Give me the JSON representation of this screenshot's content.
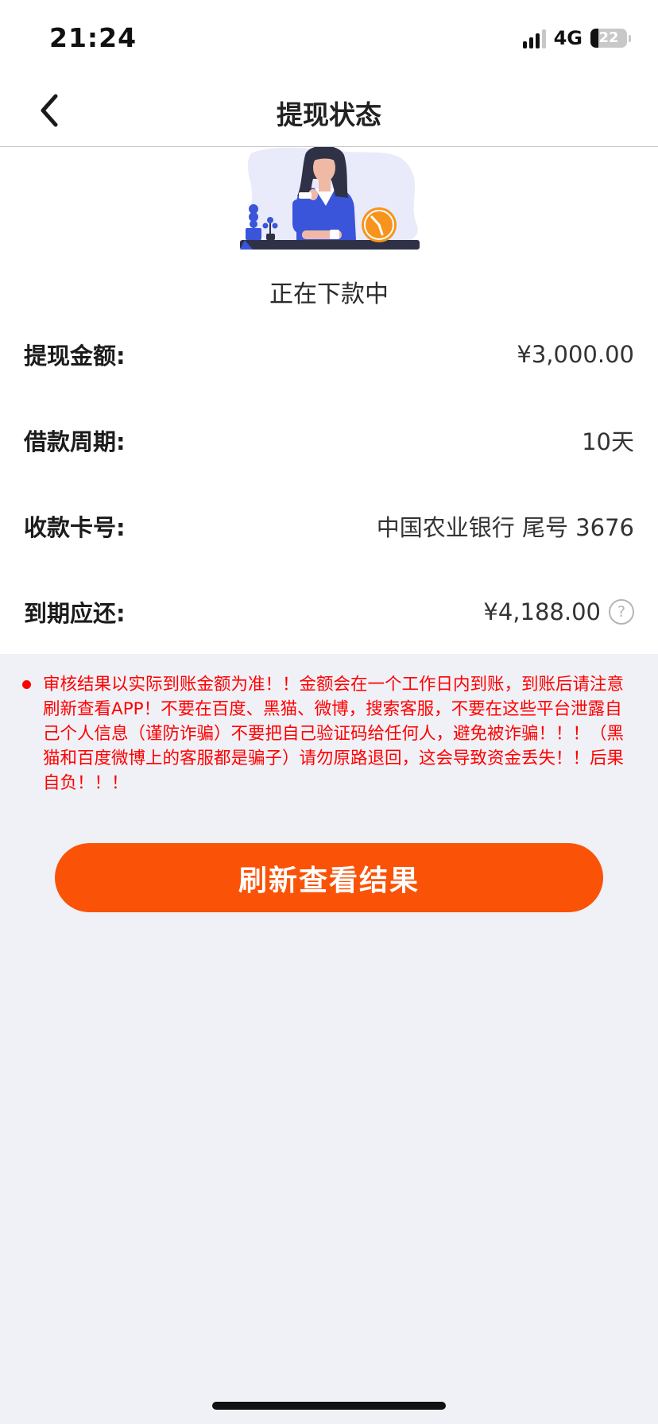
{
  "status_bar": {
    "time": "21:24",
    "network": "4G",
    "battery": "22",
    "icons": [
      "signal-bars-icon",
      "battery-icon"
    ]
  },
  "header": {
    "title": "提现状态",
    "back_icon": "chevron-left-icon"
  },
  "status": {
    "illustration": "woman-waiting-clock-illustration",
    "text": "正在下款中"
  },
  "details": [
    {
      "label": "提现金额:",
      "value": "¥3,000.00"
    },
    {
      "label": "借款周期:",
      "value": "10天"
    },
    {
      "label": "收款卡号:",
      "value": "中国农业银行 尾号 3676"
    },
    {
      "label": "到期应还:",
      "value": "¥4,188.00",
      "help_icon": "?"
    }
  ],
  "notice": {
    "text": "审核结果以实际到账金额为准！！金额会在一个工作日内到账，到账后请注意刷新查看APP！不要在百度、黑猫、微博，搜索客服，不要在这些平台泄露自己个人信息（谨防诈骗）不要把自己验证码给任何人，避免被诈骗！！！（黑猫和百度微博上的客服都是骗子）请勿原路退回，这会导致资金丢失！！后果自负！！！"
  },
  "actions": {
    "refresh_label": "刷新查看结果"
  },
  "colors": {
    "accent": "#fa5307",
    "notice": "#ff0000",
    "background": "#f0f1f6",
    "illustration_blue": "#3a55d9",
    "illustration_orange": "#f7941d"
  }
}
